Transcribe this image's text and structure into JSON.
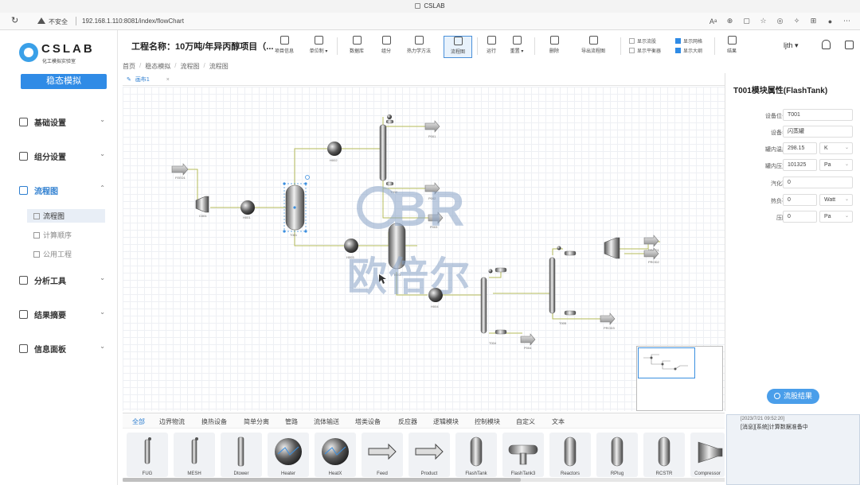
{
  "browser": {
    "tab_title": "CSLAB",
    "insecure_label": "不安全",
    "url": "192.168.1.110:8081/index/flowChart"
  },
  "sidebar": {
    "logo_text": "CSLAB",
    "logo_sub": "化工模拟实验室",
    "mode_button": "稳态模拟",
    "nav": [
      {
        "label": "基础设置"
      },
      {
        "label": "组分设置"
      },
      {
        "label": "流程图"
      },
      {
        "label": "分析工具"
      },
      {
        "label": "结果摘要"
      },
      {
        "label": "信息面板"
      }
    ],
    "sub_nav": [
      {
        "label": "流程图"
      },
      {
        "label": "计算顺序"
      },
      {
        "label": "公用工程"
      }
    ]
  },
  "toolbar": {
    "project_title": "工程名称：10万吨/年异丙醇项目（...",
    "buttons": [
      {
        "label": "项目信息"
      },
      {
        "label": "单位制 ▾"
      },
      {
        "label": "数据库"
      },
      {
        "label": "组分"
      },
      {
        "label": "热力学方法"
      },
      {
        "label": "流程图"
      },
      {
        "label": "运行"
      },
      {
        "label": "重置 ▾"
      },
      {
        "label": "删除"
      },
      {
        "label": "导出流程图"
      },
      {
        "label": "结果"
      }
    ],
    "checkboxes": [
      {
        "label": "显示流股",
        "checked": false
      },
      {
        "label": "显示网格",
        "checked": true
      },
      {
        "label": "显示平衡器",
        "checked": false
      },
      {
        "label": "显示大纲",
        "checked": true
      }
    ],
    "user": "ljth ▾"
  },
  "breadcrumb": [
    "首页",
    "稳态模拟",
    "流程图",
    "流程图"
  ],
  "canvas": {
    "tab_label": "画布1",
    "tab_close": "×",
    "labels": {
      "feed1": "FEED1",
      "c001": "C001",
      "h001": "H001",
      "t001": "T001",
      "h002": "H002",
      "h003": "H003",
      "t002": "T002",
      "h004": "H004",
      "t003": "T003",
      "t004": "T004",
      "t005": "T005",
      "p001": "P001",
      "p002": "P002",
      "p003": "P003",
      "p004": "P004",
      "prod1": "PROD1",
      "prod2": "PROD2",
      "prod3": "PROD3"
    }
  },
  "watermark": {
    "line1": "BR",
    "line2": "欧倍尔"
  },
  "props": {
    "title": "T001模块属性(FlashTank)",
    "fields": [
      {
        "label": "设备位号",
        "value": "T001"
      },
      {
        "label": "设备名",
        "value": "闪蒸罐"
      },
      {
        "label": "罐内温度",
        "value": "298.15",
        "unit": "K"
      },
      {
        "label": "罐内压力",
        "value": "101325",
        "unit": "Pa"
      },
      {
        "label": "汽化率",
        "value": "0"
      },
      {
        "label": "热负荷",
        "value": "0",
        "unit": "Watt"
      },
      {
        "label": "压降",
        "value": "0",
        "unit": "Pa"
      }
    ],
    "result_button": "流股结果"
  },
  "palette": {
    "tabs": [
      "全部",
      "边界物流",
      "换热设备",
      "简单分离",
      "管路",
      "流体输送",
      "塔类设备",
      "反应器",
      "逻辑模块",
      "控制模块",
      "自定义",
      "文本"
    ],
    "items": [
      {
        "label": "FUG",
        "icon": "column-icon"
      },
      {
        "label": "MESH",
        "icon": "column-icon"
      },
      {
        "label": "Dtower",
        "icon": "tower-icon"
      },
      {
        "label": "Heater",
        "icon": "heater-icon"
      },
      {
        "label": "HeatX",
        "icon": "heatx-icon"
      },
      {
        "label": "Feed",
        "icon": "arrow-icon"
      },
      {
        "label": "Product",
        "icon": "arrow-icon"
      },
      {
        "label": "FlashTank",
        "icon": "vessel-icon"
      },
      {
        "label": "FlashTank3",
        "icon": "tee-icon"
      },
      {
        "label": "Reactors",
        "icon": "vessel-icon"
      },
      {
        "label": "RPlug",
        "icon": "vessel-icon"
      },
      {
        "label": "RCSTR",
        "icon": "vessel-icon"
      },
      {
        "label": "Compressor",
        "icon": "compressor-icon"
      }
    ]
  },
  "message": {
    "time": "[2023/7/21 09:52:20]",
    "text": "[消息][系统]计算数据准备中"
  },
  "colors": {
    "accent": "#2f8be6",
    "stream": "#b6bb5a"
  }
}
